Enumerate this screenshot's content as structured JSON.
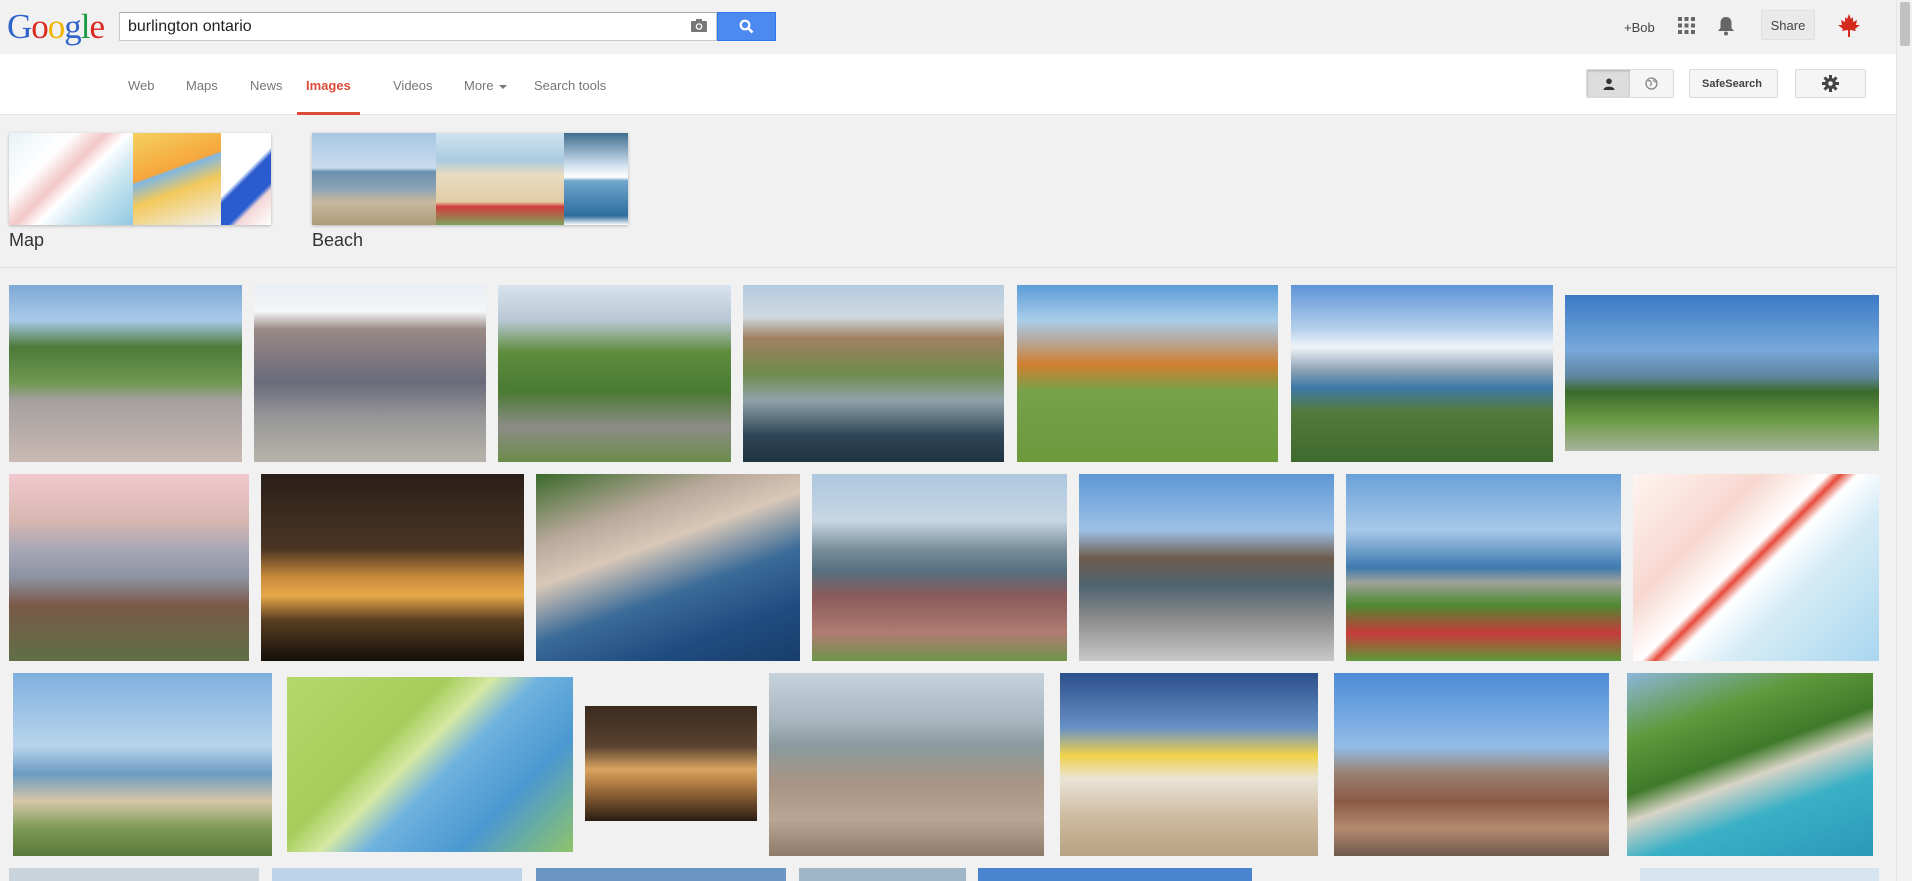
{
  "search": {
    "query": "burlington ontario"
  },
  "header": {
    "plus_user": "+Bob",
    "share_label": "Share"
  },
  "nav": {
    "tabs": [
      "Web",
      "Maps",
      "News",
      "Images",
      "Videos",
      "More",
      "Search tools"
    ],
    "active": "Images",
    "safesearch_label": "SafeSearch"
  },
  "categories": [
    {
      "label": "Map"
    },
    {
      "label": "Beach"
    }
  ],
  "colors": {
    "accent": "#dd4b39",
    "search_button": "#4d8af0"
  },
  "results": {
    "row1": [
      "clock-street",
      "burlington-mall",
      "memorial-flags",
      "pier-aerial",
      "autumn-park",
      "lake-shore",
      "waterfront-trees"
    ],
    "row2": [
      "pink-lakefront",
      "night-skyline",
      "city-aerial",
      "promenade",
      "hospital-parking",
      "park-flowers",
      "region-map"
    ],
    "row3": [
      "hydro-tower",
      "points-of-interest-map",
      "night-lake",
      "downtown-aerial",
      "sailboats",
      "rooftops",
      "pier-park"
    ]
  }
}
